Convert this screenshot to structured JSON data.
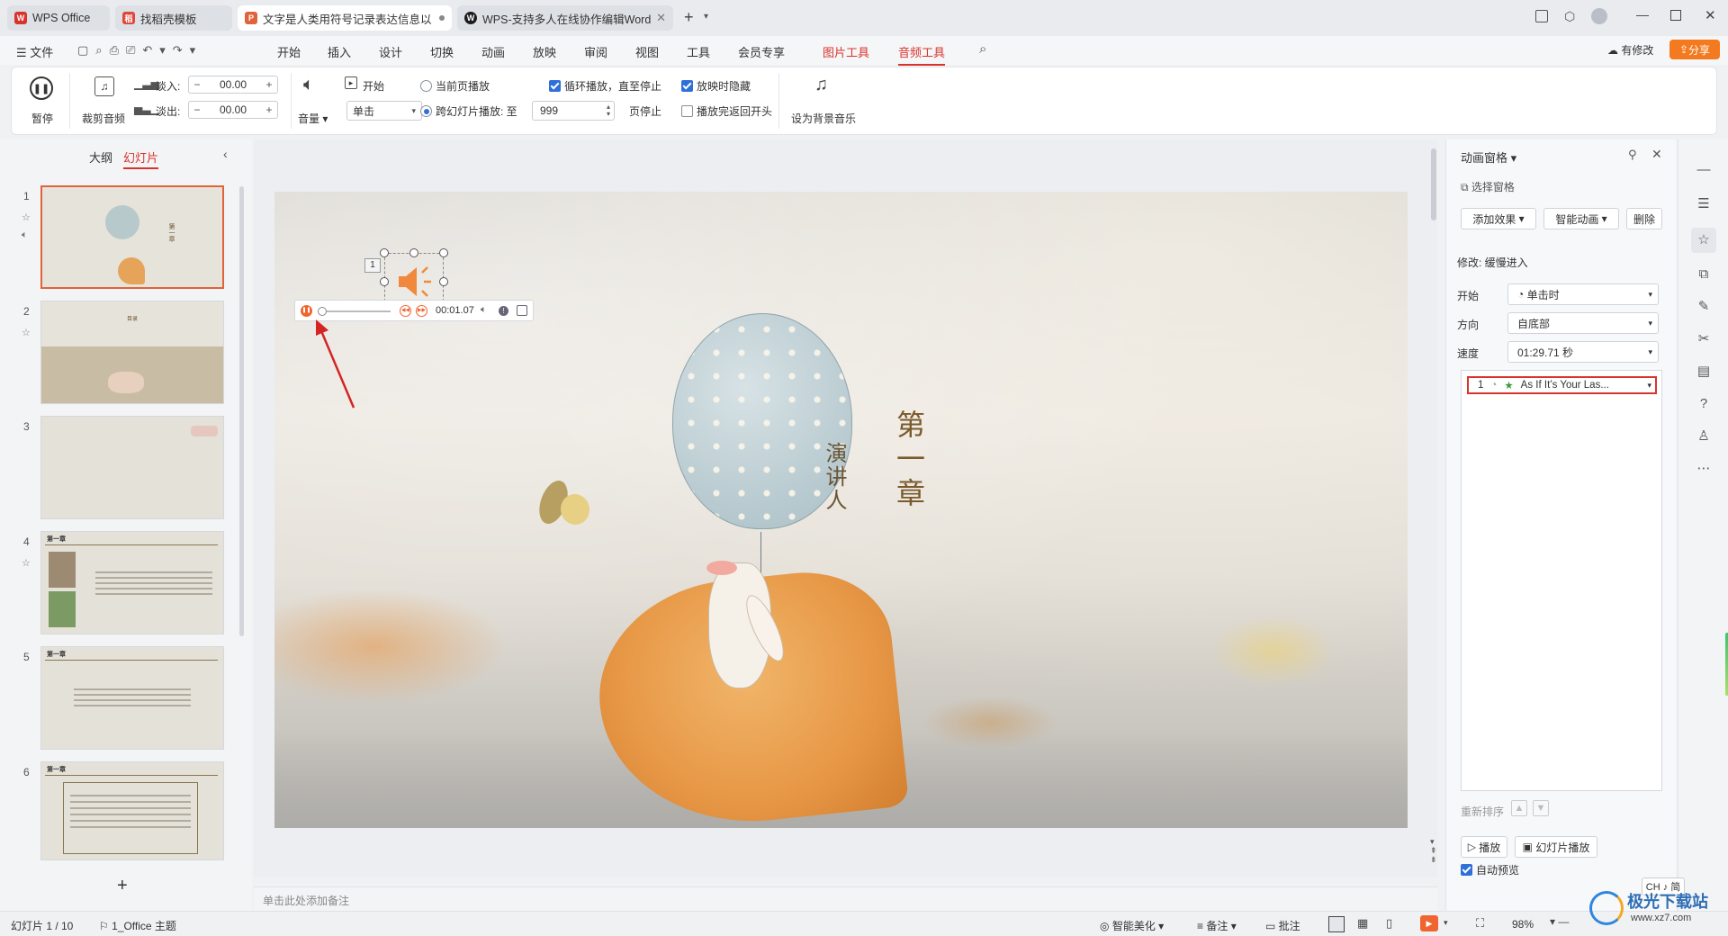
{
  "tabs": [
    {
      "label": "WPS Office",
      "icon": "wps-logo-icon"
    },
    {
      "label": "找稻壳模板",
      "icon": "docer-icon"
    },
    {
      "label": "文字是人类用符号记录表达信息以",
      "icon": "ppt-icon"
    },
    {
      "label": "WPS-支持多人在线协作编辑Word",
      "icon": "wps-web-icon"
    }
  ],
  "tab_new": "+",
  "menu": {
    "file": "文件",
    "items": [
      "开始",
      "插入",
      "设计",
      "切换",
      "动画",
      "放映",
      "审阅",
      "视图",
      "工具",
      "会员专享",
      "图片工具",
      "音频工具"
    ],
    "modified": "有修改",
    "share": "分享"
  },
  "ribbon": {
    "pause": "暂停",
    "trim": "裁剪音频",
    "fade_in": "淡入:",
    "fade_out": "淡出:",
    "fade_in_value": "00.00",
    "fade_out_value": "00.00",
    "volume": "音量",
    "start": "开始",
    "start_select": "单击",
    "current_page_play": "当前页播放",
    "cross_slide_play": "跨幻灯片播放: 至",
    "cross_slide_value": "999",
    "page_stop": "页停止",
    "loop_play": "循环播放，直至停止",
    "hide_on_show": "放映时隐藏",
    "rewind_after_play": "播放完返回开头",
    "set_bg_music": "设为背景音乐"
  },
  "left_panel": {
    "outline_tab": "大纲",
    "slides_tab": "幻灯片",
    "slide_numbers": [
      "1",
      "2",
      "3",
      "4",
      "5",
      "6"
    ],
    "thumb_titles": [
      "第一章",
      "目录",
      "",
      "第一章",
      "第一章",
      "第一章"
    ],
    "add_slide": "+"
  },
  "slide": {
    "title": "第一章",
    "subtitle": "演讲人",
    "audio_marker": "1",
    "player_time": "00:01.07"
  },
  "notes_placeholder": "单击此处添加备注",
  "animation_pane": {
    "title": "动画窗格",
    "select_pane": "选择窗格",
    "add_effect": "添加效果",
    "smart_anim": "智能动画",
    "delete": "删除",
    "modify": "修改: 缓慢进入",
    "start_label": "开始",
    "start_value": "单击时",
    "direction_label": "方向",
    "direction_value": "自底部",
    "speed_label": "速度",
    "speed_value": "01:29.71 秒",
    "item_index": "1",
    "item_name": "As If It’s Your Las...",
    "reorder": "重新排序",
    "play": "播放",
    "slideshow": "幻灯片播放",
    "auto_preview": "自动预览"
  },
  "statusbar": {
    "slide_info": "幻灯片 1 / 10",
    "theme": "1_Office 主题",
    "smart_beautify": "智能美化",
    "notes": "备注",
    "comments": "批注",
    "zoom": "98%",
    "ime": "CH ♪ 简"
  },
  "watermark": {
    "text": "极光下载站",
    "url": "www.xz7.com"
  },
  "colors": {
    "accent_red": "#d9342b",
    "ppt_orange": "#e0643a",
    "share_orange": "#f47a20",
    "checkbox_blue": "#2f6fd8"
  }
}
